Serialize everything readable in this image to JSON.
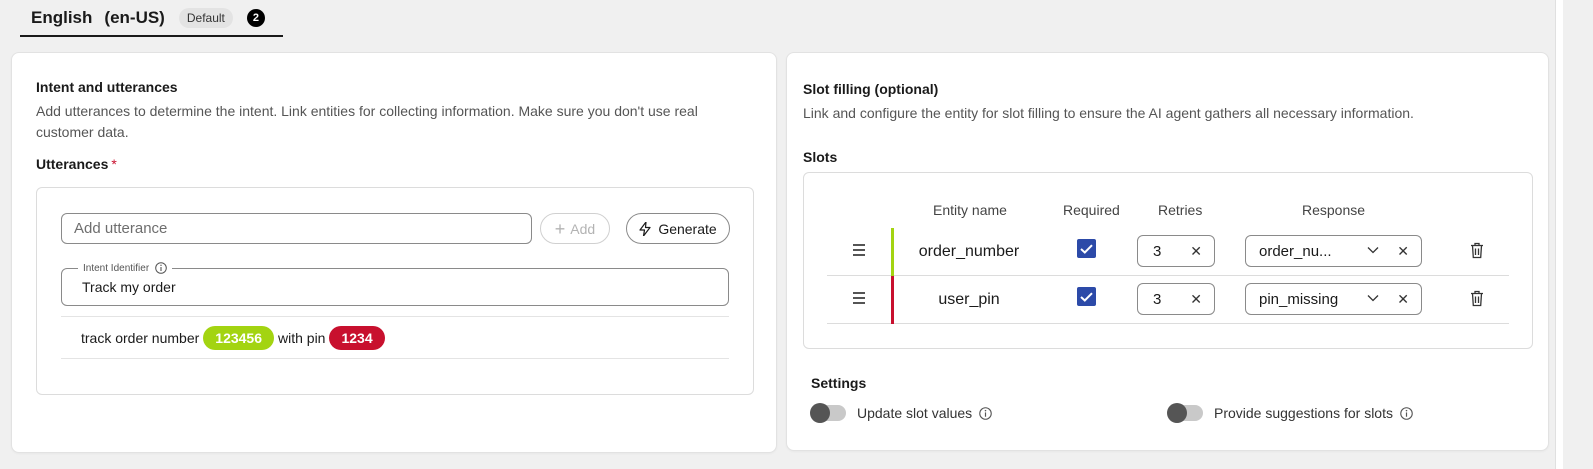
{
  "language_tab": {
    "name": "English",
    "code": "(en-US)",
    "badge": "Default",
    "count": "2"
  },
  "intent": {
    "title": "Intent and utterances",
    "description": "Add utterances to determine the intent. Link entities for collecting information. Make sure you don't use real customer data.",
    "utterances_label": "Utterances",
    "required_marker": "*",
    "add_placeholder": "Add utterance",
    "add_label": "Add",
    "generate_label": "Generate",
    "intent_identifier_label": "Intent Identifier",
    "intent_identifier_value": "Track my order",
    "utterance": {
      "text_before": "track order number",
      "entity1": "123456",
      "text_middle": "with pin",
      "entity2": "1234"
    }
  },
  "slot_filling": {
    "title": "Slot filling (optional)",
    "description": "Link and configure the entity for slot filling to ensure the AI agent gathers all necessary information.",
    "slots_label": "Slots",
    "columns": [
      "Entity name",
      "Required",
      "Retries",
      "Response"
    ],
    "rows": [
      {
        "entity": "order_number",
        "required": true,
        "retries": "3",
        "response": "order_nu...",
        "color": "#a3d411"
      },
      {
        "entity": "user_pin",
        "required": true,
        "retries": "3",
        "response": "pin_missing",
        "color": "#c8102e"
      }
    ],
    "settings_label": "Settings",
    "toggles": [
      {
        "label": "Update slot values",
        "on": false
      },
      {
        "label": "Provide suggestions for slots",
        "on": false
      }
    ]
  },
  "colors": {
    "entity_green": "#a3d411",
    "entity_red": "#c8102e",
    "checkbox_blue": "#2c4aa8"
  }
}
